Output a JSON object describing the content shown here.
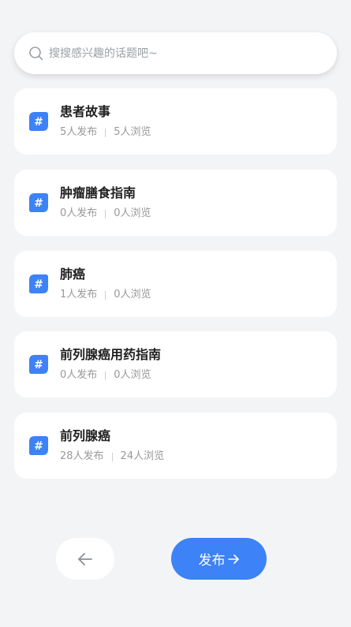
{
  "search": {
    "placeholder": "搜搜感兴趣的话题吧~"
  },
  "topics": [
    {
      "title": "患者故事",
      "posts": "5人发布",
      "views": "5人浏览"
    },
    {
      "title": "肿瘤膳食指南",
      "posts": "0人发布",
      "views": "0人浏览"
    },
    {
      "title": "肺癌",
      "posts": "1人发布",
      "views": "0人浏览"
    },
    {
      "title": "前列腺癌用药指南",
      "posts": "0人发布",
      "views": "0人浏览"
    },
    {
      "title": "前列腺癌",
      "posts": "28人发布",
      "views": "24人浏览"
    }
  ],
  "actions": {
    "publish_label": "发布"
  },
  "icons": {
    "search": "search-icon",
    "topic": "hash-icon",
    "back": "arrow-left-icon",
    "publish": "arrow-right-icon"
  },
  "colors": {
    "accent": "#3d82f6",
    "background": "#f3f4f6",
    "card": "#ffffff",
    "title": "#1f1f1f",
    "muted": "#999999"
  }
}
